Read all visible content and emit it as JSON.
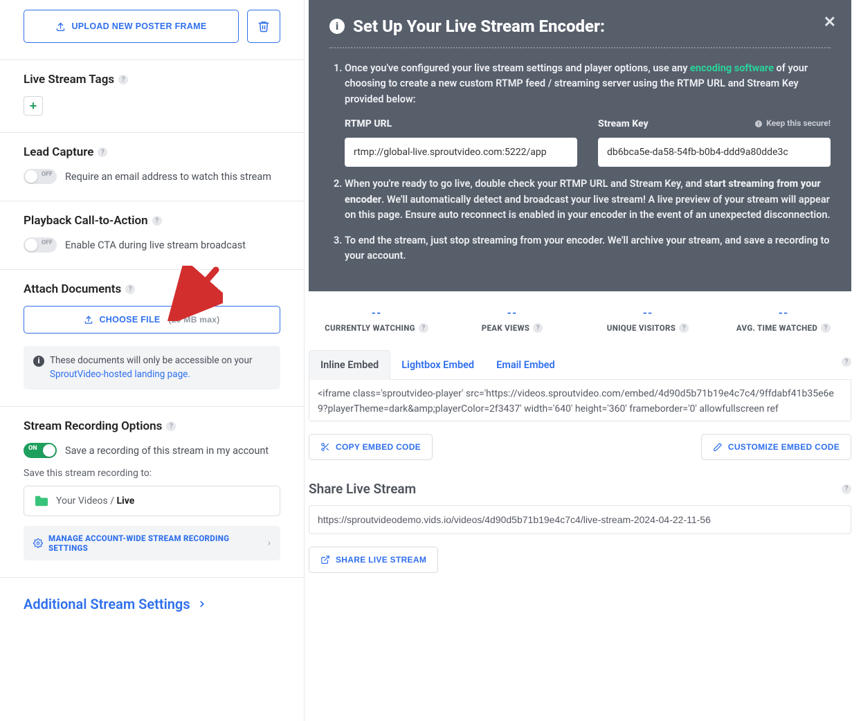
{
  "left": {
    "upload_label": "Upload New Poster Frame",
    "tags_heading": "Live Stream Tags",
    "lead_heading": "Lead Capture",
    "lead_toggle_text": "Require an email address to watch this stream",
    "cta_heading": "Playback Call-to-Action",
    "cta_toggle_text": "Enable CTA during live stream broadcast",
    "attach_heading": "Attach Documents",
    "choose_file_label": "Choose File",
    "choose_file_hint": "(20 MB max)",
    "docs_note_prefix": "These documents will only be accessible on your ",
    "docs_note_link": "SproutVideo-hosted landing page.",
    "recording_heading": "Stream Recording Options",
    "recording_toggle_text": "Save a recording of this stream in my account",
    "save_to_label": "Save this stream recording to:",
    "folder_prefix": "Your Videos / ",
    "folder_current": "Live",
    "manage_label": "Manage Account-Wide Stream Recording Settings",
    "additional_label": "Additional Stream Settings",
    "toggle_on": "ON",
    "toggle_off": "OFF"
  },
  "encoder": {
    "title": "Set Up Your Live Stream Encoder:",
    "step1_a": "Once you've configured your live stream settings and player options, use any ",
    "step1_link": "encoding software",
    "step1_b": " of your choosing to create a new custom RTMP feed / streaming server using the RTMP URL and Stream Key provided below:",
    "rtmp_label": "RTMP URL",
    "rtmp_value": "rtmp://global-live.sproutvideo.com:5222/app",
    "streamkey_label": "Stream Key",
    "streamkey_secure": "Keep this secure!",
    "streamkey_value": "db6bca5e-da58-54fb-b0b4-ddd9a80dde3c",
    "step2_a": "When you're ready to go live, double check your RTMP URL and Stream Key, and ",
    "step2_bold": "start streaming from your encoder",
    "step2_b": ". We'll automatically detect and broadcast your live stream! A live preview of your stream will appear on this page. Ensure auto reconnect is enabled in your encoder in the event of an unexpected disconnection.",
    "step3": "To end the stream, just stop streaming from your encoder. We'll archive your stream, and save a recording to your account."
  },
  "stats": {
    "placeholder": "--",
    "currently": "CURRENTLY WATCHING",
    "peak": "PEAK VIEWS",
    "unique": "UNIQUE VISITORS",
    "avg": "AVG. TIME WATCHED"
  },
  "embed": {
    "tab_inline": "Inline Embed",
    "tab_lightbox": "Lightbox Embed",
    "tab_email": "Email Embed",
    "code": "<iframe class='sproutvideo-player' src='https://videos.sproutvideo.com/embed/4d90d5b71b19e4c7c4/9ffdabf41b35e6e9?playerTheme=dark&amp;playerColor=2f3437' width='640' height='360' frameborder='0' allowfullscreen ref",
    "copy_label": "Copy Embed Code",
    "customize_label": "Customize Embed Code"
  },
  "share": {
    "heading": "Share Live Stream",
    "url": "https://sproutvideodemo.vids.io/videos/4d90d5b71b19e4c7c4/live-stream-2024-04-22-11-56",
    "button": "Share Live Stream"
  }
}
